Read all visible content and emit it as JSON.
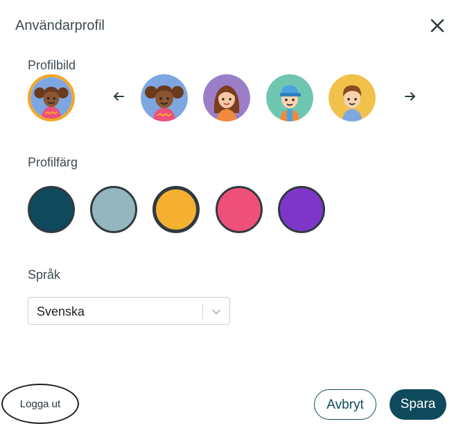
{
  "dialog": {
    "title": "Användarprofil",
    "close_icon": "close-icon"
  },
  "profile_image": {
    "label": "Profilbild",
    "selected": "girl-pigtails",
    "prev_icon": "arrow-left-icon",
    "next_icon": "arrow-right-icon",
    "options": [
      {
        "name": "girl-pigtails",
        "bg": "#7ea6e0"
      },
      {
        "name": "girl-long-hair",
        "bg": "#9b7ec8"
      },
      {
        "name": "boy-cap",
        "bg": "#6fc6b0"
      },
      {
        "name": "boy-brown-hair",
        "bg": "#f0c14b"
      }
    ]
  },
  "profile_color": {
    "label": "Profilfärg",
    "selected": "#f5af31",
    "colors": [
      "#0e4a5c",
      "#94b6bf",
      "#f5af31",
      "#ee507a",
      "#7e36c8"
    ]
  },
  "language": {
    "label": "Språk",
    "value": "Svenska",
    "chevron_icon": "chevron-down-icon"
  },
  "footer": {
    "logout_label": "Logga ut",
    "cancel_label": "Avbryt",
    "save_label": "Spara"
  }
}
